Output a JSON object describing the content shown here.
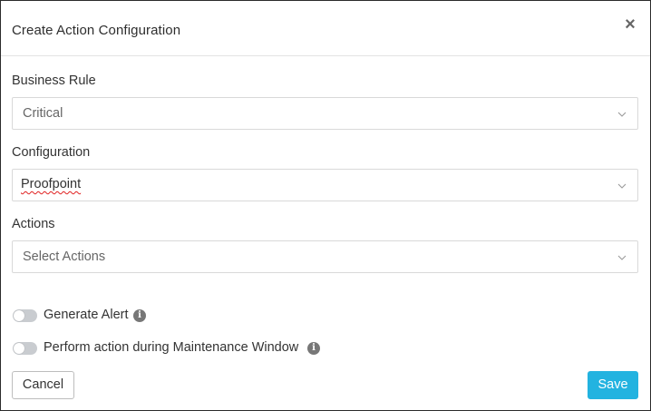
{
  "modal": {
    "title": "Create Action Configuration",
    "close_icon": "close-icon"
  },
  "fields": {
    "business_rule": {
      "label": "Business Rule",
      "value": "Critical"
    },
    "configuration": {
      "label": "Configuration",
      "value": "Proofpoint"
    },
    "actions": {
      "label": "Actions",
      "placeholder": "Select Actions"
    }
  },
  "toggles": {
    "generate_alert": {
      "label": "Generate Alert",
      "enabled": false
    },
    "maintenance_window": {
      "label": "Perform action during Maintenance Window",
      "enabled": false
    }
  },
  "footer": {
    "cancel_label": "Cancel",
    "save_label": "Save"
  },
  "colors": {
    "primary": "#23b3e0",
    "toggle_off": "#c9ccd0",
    "border": "#d9d9d9"
  }
}
